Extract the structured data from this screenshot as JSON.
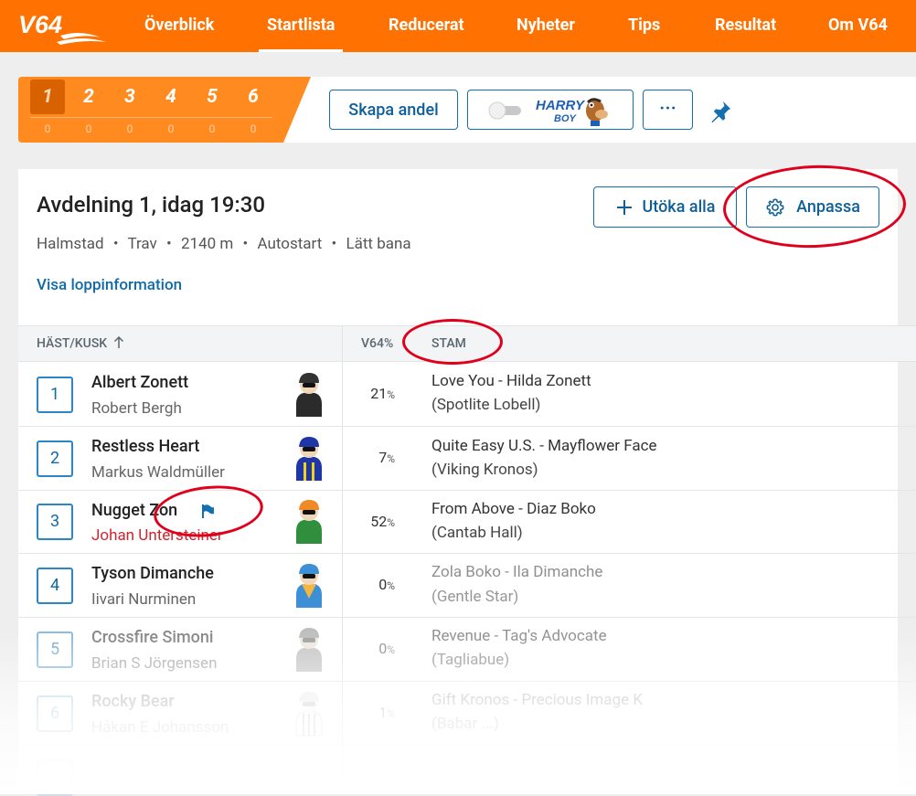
{
  "nav": {
    "logo": "V64",
    "items": [
      "Överblick",
      "Startlista",
      "Reducerat",
      "Nyheter",
      "Tips",
      "Resultat",
      "Om V64"
    ],
    "active": "Startlista"
  },
  "legs": {
    "numbers": [
      "1",
      "2",
      "3",
      "4",
      "5",
      "6"
    ],
    "counts": [
      "0",
      "0",
      "0",
      "0",
      "0",
      "0"
    ],
    "active": "1"
  },
  "toolbar": {
    "create_share": "Skapa andel",
    "harry_boy_top": "HARRY",
    "harry_boy_bottom": "BOY",
    "more": "···"
  },
  "race": {
    "title": "Avdelning 1, idag 19:30",
    "track": "Halmstad",
    "discipline": "Trav",
    "distance": "2140 m",
    "start_method": "Autostart",
    "track_condition": "Lätt bana",
    "info_link": "Visa loppinformation",
    "expand_all": "Utöka alla",
    "customize": "Anpassa"
  },
  "table": {
    "col_horse": "HÄST/KUSK",
    "col_v64": "V64%",
    "col_pedigree": "STAM",
    "rows": [
      {
        "num": "1",
        "horse": "Albert Zonett",
        "driver": "Robert Bergh",
        "pct": "21",
        "pedigree": "Love You - Hilda Zonett",
        "dam_sire": "(Spotlite Lobell)"
      },
      {
        "num": "2",
        "horse": "Restless Heart",
        "driver": "Markus Waldmüller",
        "pct": "7",
        "pedigree": "Quite Easy U.S. - Mayflower Face",
        "dam_sire": "(Viking Kronos)"
      },
      {
        "num": "3",
        "horse": "Nugget Zon",
        "driver": "Johan Untersteiner",
        "pct": "52",
        "pedigree": "From Above - Diaz Boko",
        "dam_sire": "(Cantab Hall)"
      },
      {
        "num": "4",
        "horse": "Tyson Dimanche",
        "driver": "Iivari Nurminen",
        "pct": "0",
        "pedigree": "Zola Boko - Ila Dimanche",
        "dam_sire": "(Gentle Star)"
      },
      {
        "num": "5",
        "horse": "Crossfire Simoni",
        "driver": "Brian S Jörgensen",
        "pct": "0",
        "pedigree": "Revenue - Tag's Advocate",
        "dam_sire": "(Tagliabue)"
      },
      {
        "num": "6",
        "horse": "Rocky Bear",
        "driver": "Håkan E Johansson",
        "pct": "1",
        "pedigree": "Gift Kronos - Precious Image K",
        "dam_sire": "(Babar ...)"
      }
    ],
    "pct_unit": "%"
  },
  "colors": {
    "brand_orange": "#ff7100",
    "link_blue": "#0f6aa8",
    "annotation_red": "#e0001b",
    "driver_change_red": "#d0252f"
  }
}
